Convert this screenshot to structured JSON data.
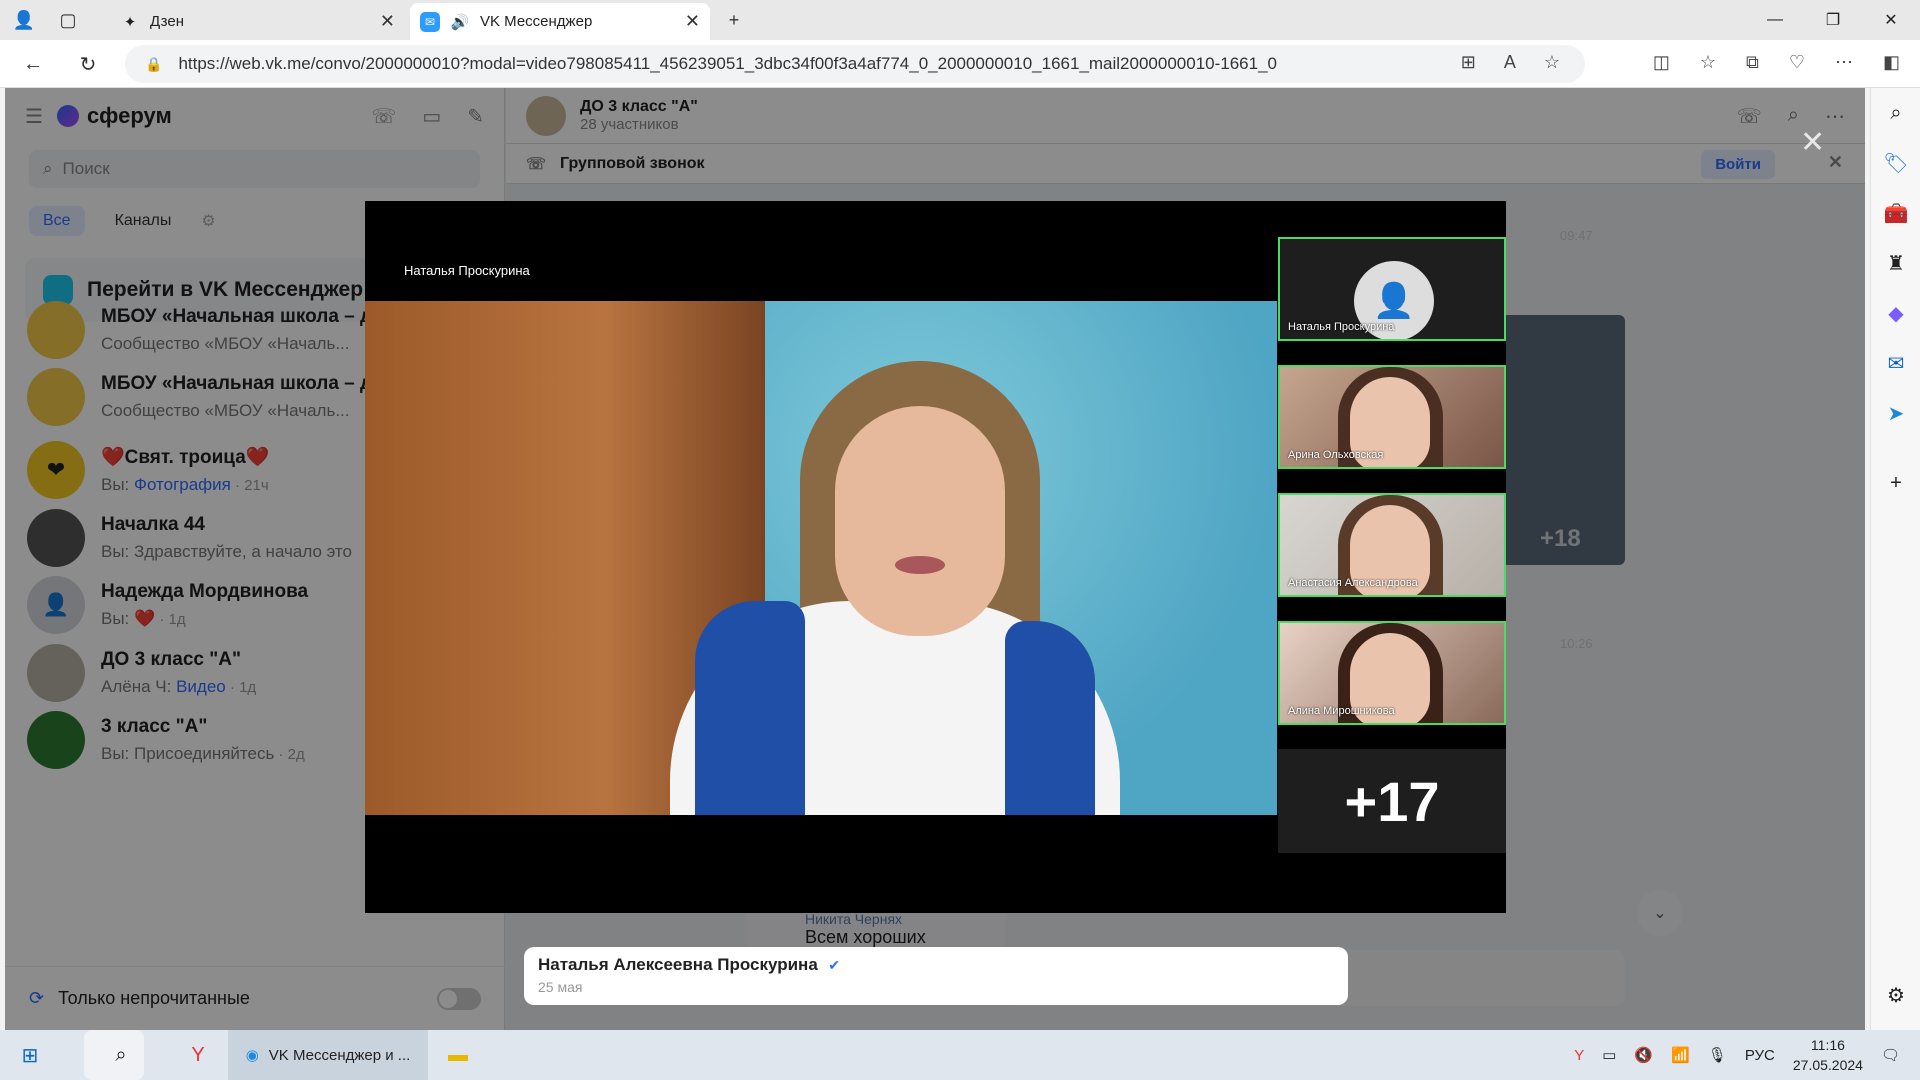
{
  "browser": {
    "tabs": [
      {
        "title": "Дзен",
        "icon": "dzen-icon"
      },
      {
        "title": "VK Мессенджер",
        "icon": "vk-messenger-icon"
      }
    ],
    "url": "https://web.vk.me/convo/2000000010?modal=video798085411_456239051_3dbc34f00f3a4af774_0_2000000010_1661_mail2000000010-1661_0"
  },
  "sidebar": {
    "brand": "сферум",
    "search_placeholder": "Поиск",
    "filters": [
      "Все",
      "Каналы"
    ],
    "promo": "Перейти в VK Мессенджер",
    "chats": [
      {
        "name": "МБОУ «Начальная школа – д",
        "preview": "Сообщество «МБОУ «Началь...",
        "link": "",
        "time": ""
      },
      {
        "name": "МБОУ «Начальная школа – д",
        "preview": "Сообщество «МБОУ «Началь...",
        "link": "",
        "time": ""
      },
      {
        "name": "❤️Свят. троица❤️",
        "preview": "Вы: ",
        "link": "Фотография",
        "time": " · 21ч"
      },
      {
        "name": "Началка 44",
        "preview": "Вы: Здравствуйте, а начало это",
        "link": "",
        "time": ""
      },
      {
        "name": "Надежда Мордвинова",
        "preview": "Вы: ❤️",
        "link": "",
        "time": " · 1д"
      },
      {
        "name": "ДО 3 класс \"А\"",
        "preview": "Алёна Ч: ",
        "link": "Видео",
        "time": " · 1д"
      },
      {
        "name": "3 класс \"А\"",
        "preview": "Вы: Присоединяйтесь",
        "link": "",
        "time": " · 2д"
      }
    ],
    "unread_only": "Только непрочитанные"
  },
  "chat": {
    "title": "ДО 3 класс \"А\"",
    "subtitle": "28 участников",
    "call_label": "Групповой звонок",
    "join_label": "Войти",
    "time1": "09:47",
    "time2": "10:26",
    "bg_plus": "+18",
    "bg_author": "Никита Чернях",
    "bg_message": "Всем хороших каникул"
  },
  "video": {
    "speaker": "Наталья Проскурина",
    "participants": [
      {
        "name": "Наталья Проскурина"
      },
      {
        "name": "Арина Ольховская"
      },
      {
        "name": "Анастасия Александрова"
      },
      {
        "name": "Алина Мирошникова"
      }
    ],
    "more": "+17"
  },
  "caption": {
    "author": "Наталья Алексеевна Проскурина",
    "date": "25 мая"
  },
  "taskbar": {
    "edge_label": "VK Мессенджер и ...",
    "lang": "РУС",
    "time": "11:16",
    "date": "27.05.2024"
  }
}
